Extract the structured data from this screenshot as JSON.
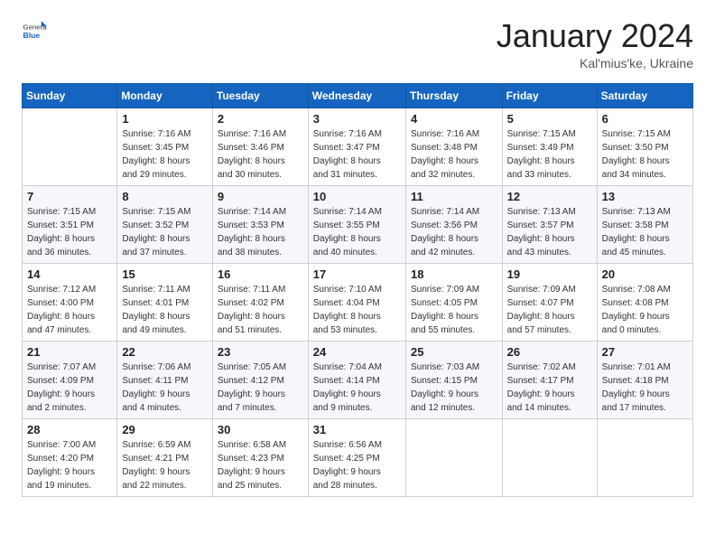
{
  "logo": {
    "general": "General",
    "blue": "Blue"
  },
  "header": {
    "month": "January 2024",
    "location": "Kal'mius'ke, Ukraine"
  },
  "weekdays": [
    "Sunday",
    "Monday",
    "Tuesday",
    "Wednesday",
    "Thursday",
    "Friday",
    "Saturday"
  ],
  "weeks": [
    [
      {
        "day": "",
        "sunrise": "",
        "sunset": "",
        "daylight": ""
      },
      {
        "day": "1",
        "sunrise": "Sunrise: 7:16 AM",
        "sunset": "Sunset: 3:45 PM",
        "daylight": "Daylight: 8 hours and 29 minutes."
      },
      {
        "day": "2",
        "sunrise": "Sunrise: 7:16 AM",
        "sunset": "Sunset: 3:46 PM",
        "daylight": "Daylight: 8 hours and 30 minutes."
      },
      {
        "day": "3",
        "sunrise": "Sunrise: 7:16 AM",
        "sunset": "Sunset: 3:47 PM",
        "daylight": "Daylight: 8 hours and 31 minutes."
      },
      {
        "day": "4",
        "sunrise": "Sunrise: 7:16 AM",
        "sunset": "Sunset: 3:48 PM",
        "daylight": "Daylight: 8 hours and 32 minutes."
      },
      {
        "day": "5",
        "sunrise": "Sunrise: 7:15 AM",
        "sunset": "Sunset: 3:49 PM",
        "daylight": "Daylight: 8 hours and 33 minutes."
      },
      {
        "day": "6",
        "sunrise": "Sunrise: 7:15 AM",
        "sunset": "Sunset: 3:50 PM",
        "daylight": "Daylight: 8 hours and 34 minutes."
      }
    ],
    [
      {
        "day": "7",
        "sunrise": "Sunrise: 7:15 AM",
        "sunset": "Sunset: 3:51 PM",
        "daylight": "Daylight: 8 hours and 36 minutes."
      },
      {
        "day": "8",
        "sunrise": "Sunrise: 7:15 AM",
        "sunset": "Sunset: 3:52 PM",
        "daylight": "Daylight: 8 hours and 37 minutes."
      },
      {
        "day": "9",
        "sunrise": "Sunrise: 7:14 AM",
        "sunset": "Sunset: 3:53 PM",
        "daylight": "Daylight: 8 hours and 38 minutes."
      },
      {
        "day": "10",
        "sunrise": "Sunrise: 7:14 AM",
        "sunset": "Sunset: 3:55 PM",
        "daylight": "Daylight: 8 hours and 40 minutes."
      },
      {
        "day": "11",
        "sunrise": "Sunrise: 7:14 AM",
        "sunset": "Sunset: 3:56 PM",
        "daylight": "Daylight: 8 hours and 42 minutes."
      },
      {
        "day": "12",
        "sunrise": "Sunrise: 7:13 AM",
        "sunset": "Sunset: 3:57 PM",
        "daylight": "Daylight: 8 hours and 43 minutes."
      },
      {
        "day": "13",
        "sunrise": "Sunrise: 7:13 AM",
        "sunset": "Sunset: 3:58 PM",
        "daylight": "Daylight: 8 hours and 45 minutes."
      }
    ],
    [
      {
        "day": "14",
        "sunrise": "Sunrise: 7:12 AM",
        "sunset": "Sunset: 4:00 PM",
        "daylight": "Daylight: 8 hours and 47 minutes."
      },
      {
        "day": "15",
        "sunrise": "Sunrise: 7:11 AM",
        "sunset": "Sunset: 4:01 PM",
        "daylight": "Daylight: 8 hours and 49 minutes."
      },
      {
        "day": "16",
        "sunrise": "Sunrise: 7:11 AM",
        "sunset": "Sunset: 4:02 PM",
        "daylight": "Daylight: 8 hours and 51 minutes."
      },
      {
        "day": "17",
        "sunrise": "Sunrise: 7:10 AM",
        "sunset": "Sunset: 4:04 PM",
        "daylight": "Daylight: 8 hours and 53 minutes."
      },
      {
        "day": "18",
        "sunrise": "Sunrise: 7:09 AM",
        "sunset": "Sunset: 4:05 PM",
        "daylight": "Daylight: 8 hours and 55 minutes."
      },
      {
        "day": "19",
        "sunrise": "Sunrise: 7:09 AM",
        "sunset": "Sunset: 4:07 PM",
        "daylight": "Daylight: 8 hours and 57 minutes."
      },
      {
        "day": "20",
        "sunrise": "Sunrise: 7:08 AM",
        "sunset": "Sunset: 4:08 PM",
        "daylight": "Daylight: 9 hours and 0 minutes."
      }
    ],
    [
      {
        "day": "21",
        "sunrise": "Sunrise: 7:07 AM",
        "sunset": "Sunset: 4:09 PM",
        "daylight": "Daylight: 9 hours and 2 minutes."
      },
      {
        "day": "22",
        "sunrise": "Sunrise: 7:06 AM",
        "sunset": "Sunset: 4:11 PM",
        "daylight": "Daylight: 9 hours and 4 minutes."
      },
      {
        "day": "23",
        "sunrise": "Sunrise: 7:05 AM",
        "sunset": "Sunset: 4:12 PM",
        "daylight": "Daylight: 9 hours and 7 minutes."
      },
      {
        "day": "24",
        "sunrise": "Sunrise: 7:04 AM",
        "sunset": "Sunset: 4:14 PM",
        "daylight": "Daylight: 9 hours and 9 minutes."
      },
      {
        "day": "25",
        "sunrise": "Sunrise: 7:03 AM",
        "sunset": "Sunset: 4:15 PM",
        "daylight": "Daylight: 9 hours and 12 minutes."
      },
      {
        "day": "26",
        "sunrise": "Sunrise: 7:02 AM",
        "sunset": "Sunset: 4:17 PM",
        "daylight": "Daylight: 9 hours and 14 minutes."
      },
      {
        "day": "27",
        "sunrise": "Sunrise: 7:01 AM",
        "sunset": "Sunset: 4:18 PM",
        "daylight": "Daylight: 9 hours and 17 minutes."
      }
    ],
    [
      {
        "day": "28",
        "sunrise": "Sunrise: 7:00 AM",
        "sunset": "Sunset: 4:20 PM",
        "daylight": "Daylight: 9 hours and 19 minutes."
      },
      {
        "day": "29",
        "sunrise": "Sunrise: 6:59 AM",
        "sunset": "Sunset: 4:21 PM",
        "daylight": "Daylight: 9 hours and 22 minutes."
      },
      {
        "day": "30",
        "sunrise": "Sunrise: 6:58 AM",
        "sunset": "Sunset: 4:23 PM",
        "daylight": "Daylight: 9 hours and 25 minutes."
      },
      {
        "day": "31",
        "sunrise": "Sunrise: 6:56 AM",
        "sunset": "Sunset: 4:25 PM",
        "daylight": "Daylight: 9 hours and 28 minutes."
      },
      {
        "day": "",
        "sunrise": "",
        "sunset": "",
        "daylight": ""
      },
      {
        "day": "",
        "sunrise": "",
        "sunset": "",
        "daylight": ""
      },
      {
        "day": "",
        "sunrise": "",
        "sunset": "",
        "daylight": ""
      }
    ]
  ]
}
